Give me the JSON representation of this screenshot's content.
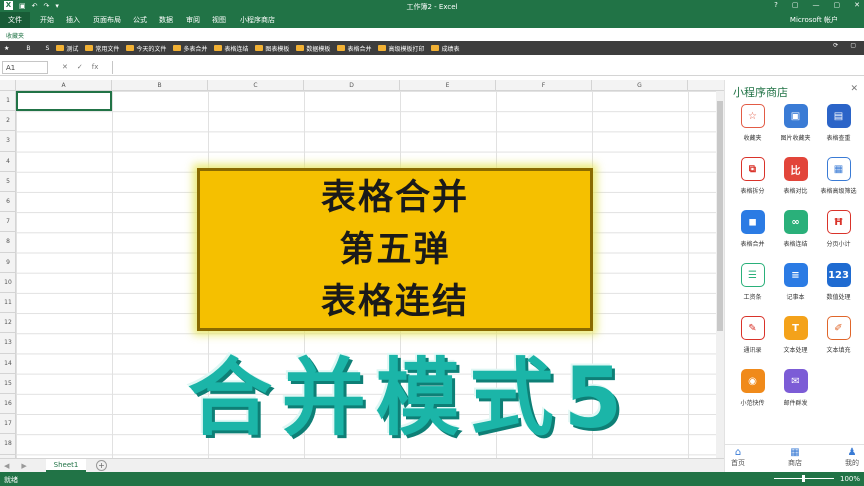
{
  "window": {
    "title": "工作簿2 - Excel",
    "logo_letter": "X",
    "controls": [
      "?",
      "▢",
      "—",
      "▢",
      "✕"
    ]
  },
  "ribbon": {
    "tabs": [
      "文件",
      "开始",
      "插入",
      "页面布局",
      "公式",
      "数据",
      "审阅",
      "视图",
      "小程序商店"
    ],
    "account": "Microsoft 帐户"
  },
  "favorites": {
    "label": "收藏夹",
    "quick": [
      "★",
      "B",
      "S"
    ],
    "bookmarks": [
      "测试",
      "常用文件",
      "今天的文件",
      "多表合并",
      "表格连结",
      "图表模板",
      "数据模板",
      "表格合并",
      "高级模板打印",
      "成绩表"
    ]
  },
  "formula_bar": {
    "name_box": "A1",
    "fx": "fx"
  },
  "grid": {
    "columns": [
      "A",
      "B",
      "C",
      "D",
      "E",
      "F",
      "G"
    ],
    "rows": [
      "1",
      "2",
      "3",
      "4",
      "5",
      "6",
      "7",
      "8",
      "9",
      "10",
      "11",
      "12",
      "13",
      "14",
      "15",
      "16",
      "17",
      "18"
    ]
  },
  "banner": {
    "line1": "表格合并",
    "line2": "第五弹",
    "line3": "表格连结"
  },
  "overlay_title": "合并模式5",
  "sheets": {
    "active": "Sheet1",
    "add": "+"
  },
  "status": {
    "ready": "就绪",
    "zoom": "100%"
  },
  "panel": {
    "title": "小程序商店",
    "apps": [
      {
        "label": "收藏夹",
        "icon": "star-icon",
        "glyph": "☆",
        "color": "#ffffff",
        "fg": "#e25b45"
      },
      {
        "label": "图片收藏夹",
        "icon": "image-icon",
        "glyph": "▣",
        "color": "#3a7bd5",
        "fg": "#ffffff"
      },
      {
        "label": "表格查重",
        "icon": "book-icon",
        "glyph": "▤",
        "color": "#2b64c8",
        "fg": "#ffffff"
      },
      {
        "label": "表格拆分",
        "icon": "split-icon",
        "glyph": "⧉",
        "color": "#ffffff",
        "fg": "#d9332a"
      },
      {
        "label": "表格对比",
        "icon": "compare-icon",
        "glyph": "比",
        "color": "#e2453a",
        "fg": "#ffffff"
      },
      {
        "label": "表格高级筛选",
        "icon": "grid-icon",
        "glyph": "▦",
        "color": "#ffffff",
        "fg": "#3a7bd5"
      },
      {
        "label": "表格合并",
        "icon": "merge-icon",
        "glyph": "◼",
        "color": "#2b7be4",
        "fg": "#ffffff"
      },
      {
        "label": "表格连结",
        "icon": "link-icon",
        "glyph": "∞",
        "color": "#2ab07a",
        "fg": "#ffffff"
      },
      {
        "label": "分页小计",
        "icon": "pagebreak-icon",
        "glyph": "Ħ",
        "color": "#ffffff",
        "fg": "#d9332a"
      },
      {
        "label": "工资条",
        "icon": "payslip-icon",
        "glyph": "☰",
        "color": "#ffffff",
        "fg": "#2ab07a"
      },
      {
        "label": "记事本",
        "icon": "notepad-icon",
        "glyph": "≡",
        "color": "#2b7be4",
        "fg": "#ffffff"
      },
      {
        "label": "数值处理",
        "icon": "number-icon",
        "glyph": "123",
        "color": "#1f6bd1",
        "fg": "#ffffff"
      },
      {
        "label": "通讯录",
        "icon": "contacts-icon",
        "glyph": "✎",
        "color": "#ffffff",
        "fg": "#d9332a"
      },
      {
        "label": "文本处理",
        "icon": "text-icon",
        "glyph": "T",
        "color": "#f4a21a",
        "fg": "#ffffff"
      },
      {
        "label": "文本填充",
        "icon": "fill-icon",
        "glyph": "✐",
        "color": "#ffffff",
        "fg": "#e0662a"
      },
      {
        "label": "小范快传",
        "icon": "transfer-icon",
        "glyph": "◉",
        "color": "#f08a1a",
        "fg": "#ffffff"
      },
      {
        "label": "邮件群发",
        "icon": "mail-icon",
        "glyph": "✉",
        "color": "#7c5cd6",
        "fg": "#ffffff"
      }
    ],
    "nav": [
      {
        "label": "首页",
        "icon": "home-icon",
        "glyph": "⌂"
      },
      {
        "label": "商店",
        "icon": "store-icon",
        "glyph": "▦"
      },
      {
        "label": "我的",
        "icon": "user-icon",
        "glyph": "♟"
      }
    ]
  }
}
